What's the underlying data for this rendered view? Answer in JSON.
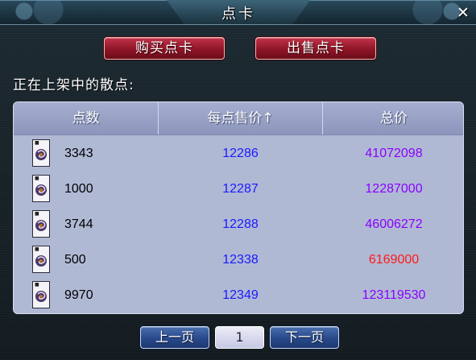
{
  "window": {
    "title": "点卡",
    "close_symbol": "✕"
  },
  "actions": {
    "buy_label": "购买点卡",
    "sell_label": "出售点卡"
  },
  "section_label": "正在上架中的散点:",
  "table": {
    "headers": {
      "points": "点数",
      "unit_price": "每点售价↑",
      "total": "总价"
    },
    "rows": [
      {
        "points": "3343",
        "unit_price": "12286",
        "total": "41072098"
      },
      {
        "points": "1000",
        "unit_price": "12287",
        "total": "12287000"
      },
      {
        "points": "3744",
        "unit_price": "12288",
        "total": "46006272"
      },
      {
        "points": "500",
        "unit_price": "12338",
        "total": "6169000",
        "total_highlight": true
      },
      {
        "points": "9970",
        "unit_price": "12349",
        "total": "123119530"
      }
    ],
    "row_icon": "card-icon"
  },
  "pagination": {
    "prev_label": "上一页",
    "current_page": "1",
    "next_label": "下一页"
  },
  "colors": {
    "unit_price": "#1a1aff",
    "total": "#8a00ff",
    "total_highlight": "#ff1a1a",
    "action_button": "#8e1526",
    "pager_button": "#28498a",
    "table_bg": "#b0b9d4"
  }
}
